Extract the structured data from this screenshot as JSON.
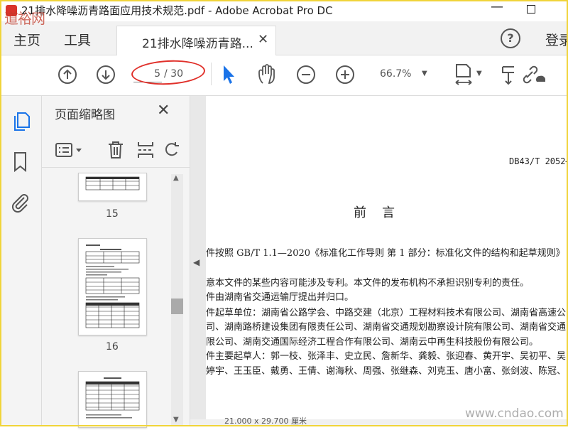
{
  "window": {
    "title": "21排水降噪沥青路面应用技术规范.pdf - Adobe Acrobat Pro DC",
    "minimize_glyph": "—",
    "watermark_top_left": "道裕网"
  },
  "tabs": {
    "home": "主页",
    "tools": "工具",
    "document": "21排水降噪沥青路...",
    "close_glyph": "✕"
  },
  "header": {
    "help_glyph": "?",
    "login": "登录"
  },
  "toolbar": {
    "page_current": "5",
    "page_total": "/ 30",
    "zoom": "66.7%"
  },
  "thumbnail_panel": {
    "title": "页面缩略图",
    "pages": [
      "15",
      "16"
    ]
  },
  "document": {
    "doc_id": "DB43/T 2052—",
    "heading": "前言",
    "lines": [
      "件按照 GB/T 1.1—2020《标准化工作导则  第 1 部分：标准化文件的结构和起草规则》",
      "意本文件的某些内容可能涉及专利。本文件的发布机构不承担识别专利的责任。",
      "件由湖南省交通运输厅提出并归口。",
      "件起草单位：湖南省公路学会、中路交建（北京）工程材料技术有限公司、湖南省高速公",
      "司、湖南路桥建设集团有限责任公司、湖南省交通规划勘察设计院有限公司、湖南省交通",
      "限公司、湖南交通国际经济工程合作有限公司、湖南云中再生科技股份有限公司。",
      "件主要起草人：郭一枝、张泽丰、史立民、詹新华、龚毅、张迎春、黄开宇、吴初平、吴",
      "婷宇、王玉臣、戴勇、王倩、谢海秋、周强、张继森、刘克玉、唐小富、张剑波、陈冠、"
    ]
  },
  "status": {
    "size_text": "21.000 x 29.700 厘米"
  },
  "watermark_bottom_right": "www.cndao.com",
  "colors": {
    "accent_blue": "#1a73e8",
    "annotation_red": "#e0302a",
    "frame_yellow": "#f0d43a"
  }
}
